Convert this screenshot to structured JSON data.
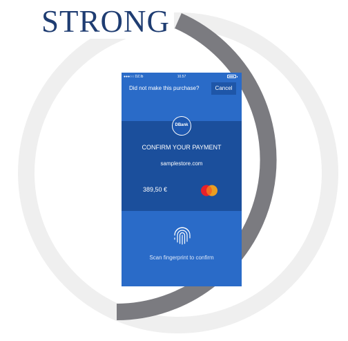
{
  "headline": "STRONG",
  "phone": {
    "status": {
      "carrier": "●●●○○ DZ.lb",
      "time": "10.57"
    },
    "top_bar": {
      "prompt": "Did not make this purchase?",
      "cancel_label": "Cancel"
    },
    "bank_logo_text": "DBank",
    "confirm_title": "CONFIRM YOUR PAYMENT",
    "merchant": "samplestore.com",
    "amount": "389,50 €",
    "card_icon": "mastercard-icon",
    "fingerprint_icon": "fingerprint-icon",
    "scan_instruction": "Scan fingerprint to confirm"
  },
  "colors": {
    "headline": "#1f3d72",
    "ring_light": "#efefef",
    "ring_dark": "#7b7b80",
    "phone_blue": "#2a6bc8",
    "band_blue": "#1b4f9c"
  }
}
